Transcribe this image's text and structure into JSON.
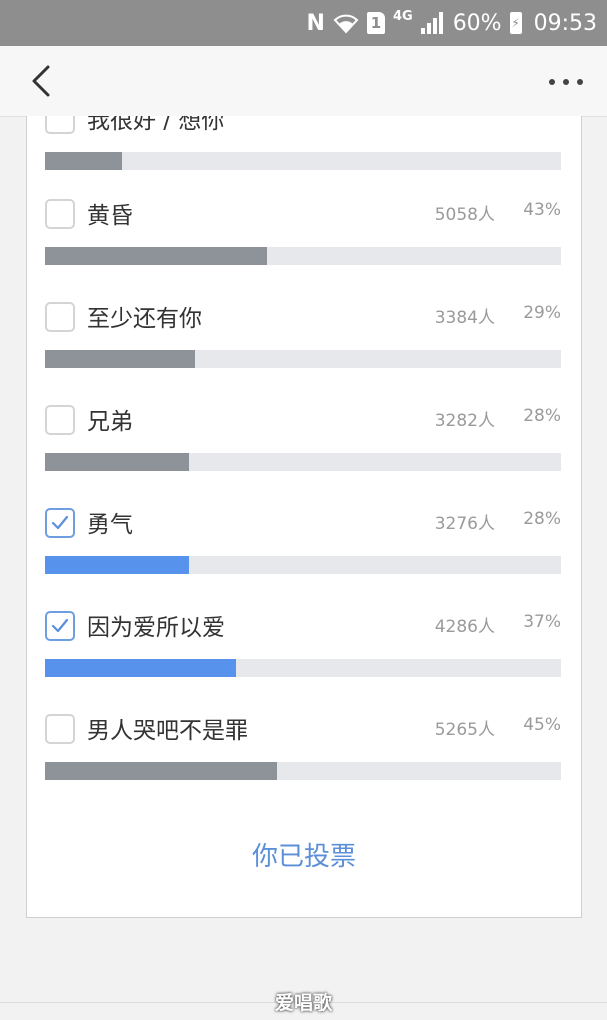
{
  "status_bar": {
    "nfc": "N",
    "sim_slot": "1",
    "network": "4G",
    "battery": "60%",
    "time": "09:53"
  },
  "poll": {
    "options": [
      {
        "label": "我很好 / 想你",
        "count": "",
        "percent": "",
        "share": 15,
        "checked": false
      },
      {
        "label": "黄昏",
        "count": "5058人",
        "percent": "43%",
        "share": 43,
        "checked": false
      },
      {
        "label": "至少还有你",
        "count": "3384人",
        "percent": "29%",
        "share": 29,
        "checked": false
      },
      {
        "label": "兄弟",
        "count": "3282人",
        "percent": "28%",
        "share": 28,
        "checked": false
      },
      {
        "label": "勇气",
        "count": "3276人",
        "percent": "28%",
        "share": 28,
        "checked": true
      },
      {
        "label": "因为爱所以爱",
        "count": "4286人",
        "percent": "37%",
        "share": 37,
        "checked": true
      },
      {
        "label": "男人哭吧不是罪",
        "count": "5265人",
        "percent": "45%",
        "share": 45,
        "checked": false
      }
    ],
    "voted_text": "你已投票"
  },
  "watermark": "爱唱歌",
  "colors": {
    "bar_default": "#8e9299",
    "bar_selected": "#5793ec",
    "track": "#e7e8ec",
    "accent_text": "#5b8fd8"
  }
}
